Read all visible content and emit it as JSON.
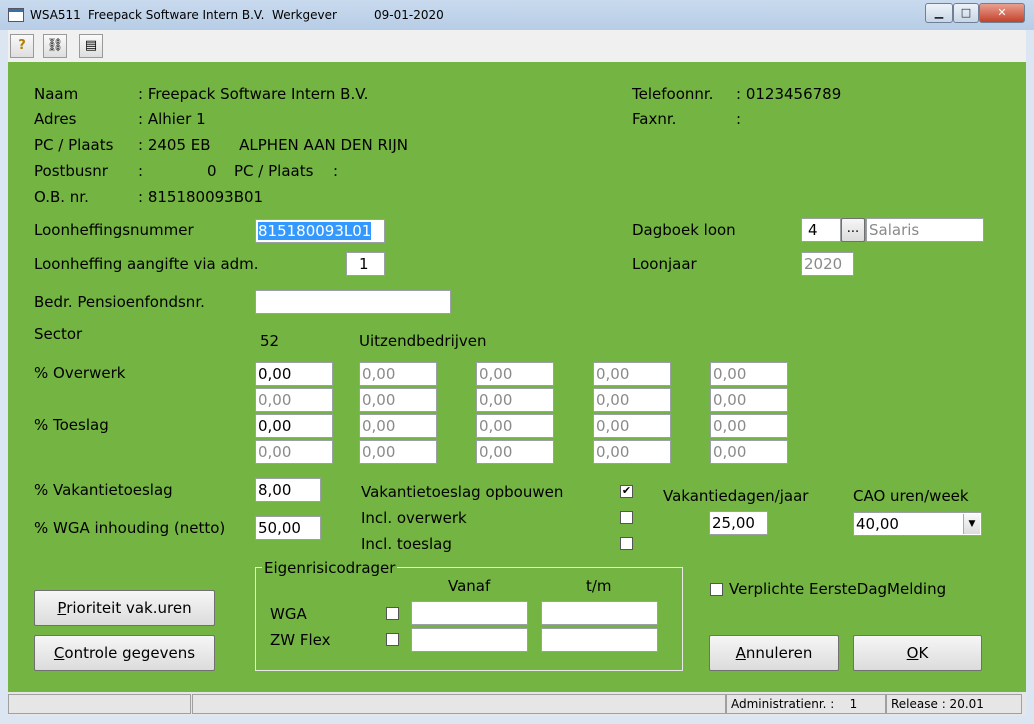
{
  "window": {
    "app_code": "WSA511",
    "company": "Freepack Software Intern B.V.  Werkgever",
    "date": "09-01-2020",
    "minimize": "▁",
    "maximize": "□",
    "close": "✕"
  },
  "toolbar": {
    "help_icon": "?",
    "binoculars_icon": "⛓",
    "print_icon": "▤"
  },
  "employer": {
    "naam_label": "Naam",
    "naam_value": ": Freepack Software Intern B.V.",
    "adres_label": "Adres",
    "adres_value": ": Alhier 1",
    "pc_label": "PC / Plaats",
    "pc_value": ": 2405 EB      ALPHEN AAN DEN RIJN",
    "postbus_label": "Postbusnr",
    "postbus_colon": ":",
    "postbus_value": "0",
    "postbus_pc_label": "PC / Plaats",
    "postbus_pc_colon": ":",
    "ob_label": "O.B. nr.",
    "ob_value": ": 815180093B01",
    "tel_label": "Telefoonnr.",
    "tel_value": ": 0123456789",
    "fax_label": "Faxnr.",
    "fax_value": ":"
  },
  "form": {
    "loonheffingsnummer_label": "Loonheffingsnummer",
    "loonheffingsnummer_value": "815180093L01",
    "aangifte_label": "Loonheffing aangifte via adm.",
    "aangifte_value": "1",
    "pensioen_label": "Bedr. Pensioenfondsnr.",
    "pensioen_value": "",
    "dagboek_label": "Dagboek loon",
    "dagboek_value": "4",
    "dagboek_btn": "...",
    "dagboek_name": "Salaris",
    "loonjaar_label": "Loonjaar",
    "loonjaar_value": "2020",
    "sector_label": "Sector",
    "sector_code": "52",
    "sector_name": "Uitzendbedrijven",
    "overwerk_label": "% Overwerk",
    "toeslag_label": "% Toeslag",
    "grid": [
      [
        "0,00",
        "0,00",
        "0,00",
        "0,00",
        "0,00"
      ],
      [
        "0,00",
        "0,00",
        "0,00",
        "0,00",
        "0,00"
      ],
      [
        "0,00",
        "0,00",
        "0,00",
        "0,00",
        "0,00"
      ],
      [
        "0,00",
        "0,00",
        "0,00",
        "0,00",
        "0,00"
      ]
    ],
    "vakantietoeslag_label": "% Vakantietoeslag",
    "vakantietoeslag_value": "8,00",
    "wga_label": "% WGA inhouding (netto)",
    "wga_value": "50,00",
    "opbouwen_label": "Vakantietoeslag opbouwen",
    "opbouwen_checked": "✔",
    "incl_overwerk_label": "Incl. overwerk",
    "incl_toeslag_label": "Incl. toeslag",
    "vakantiedagen_label": "Vakantiedagen/jaar",
    "vakantiedagen_value": "25,00",
    "cao_label": "CAO uren/week",
    "cao_value": "40,00",
    "edm_label": "Verplichte EersteDagMelding",
    "eigen_title": "Eigenrisicodrager",
    "vanaf_label": "Vanaf",
    "tm_label": "t/m",
    "wga_row_label": "WGA",
    "zw_row_label": "ZW Flex"
  },
  "buttons": {
    "prioriteit": "P",
    "prioriteit_rest": "rioriteit vak.uren",
    "controle": "C",
    "controle_rest": "ontrole gegevens",
    "annuleren": "A",
    "annuleren_rest": "nnuleren",
    "ok": "O",
    "ok_rest": "K"
  },
  "status": {
    "admin": "Administratienr. :    1",
    "release": "Release : 20.01"
  }
}
